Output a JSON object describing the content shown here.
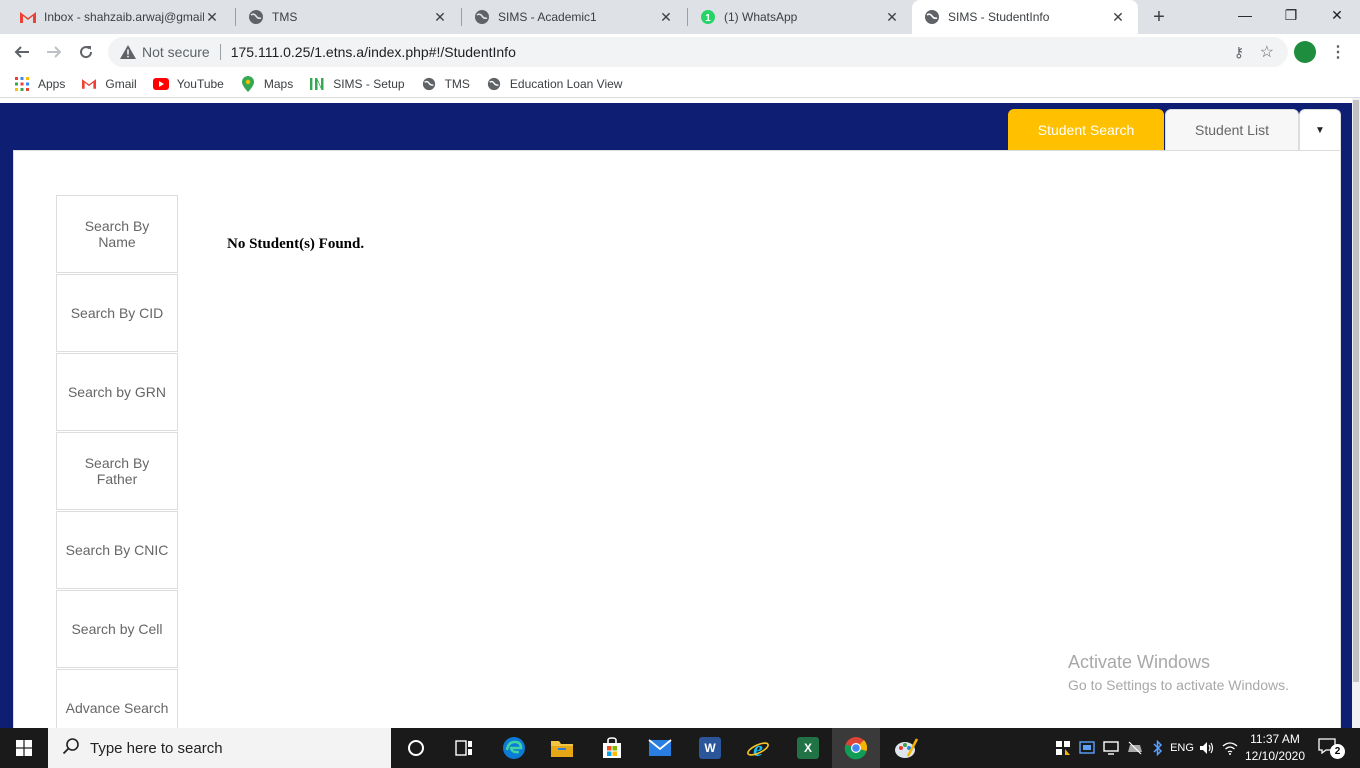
{
  "browser": {
    "tabs": [
      {
        "title": "Inbox - shahzaib.arwaj@gmail.",
        "icon": "gmail-icon"
      },
      {
        "title": "TMS",
        "icon": "globe-icon"
      },
      {
        "title": "SIMS - Academic1",
        "icon": "globe-icon"
      },
      {
        "title": "(1) WhatsApp",
        "icon": "whatsapp-icon",
        "badge": "1"
      },
      {
        "title": "SIMS - StudentInfo",
        "icon": "globe-icon"
      }
    ],
    "new_tab": "+",
    "security": "Not secure",
    "url": "175.111.0.25/1.etns.a/index.php#!/StudentInfo",
    "bookmarks": [
      "Apps",
      "Gmail",
      "YouTube",
      "Maps",
      "SIMS - Setup",
      "TMS",
      "Education Loan View"
    ]
  },
  "app": {
    "nav_tabs": {
      "student_search": "Student Search",
      "student_list": "Student List"
    },
    "side_buttons": [
      "Search By Name",
      "Search By CID",
      "Search by GRN",
      "Search By Father",
      "Search By CNIC",
      "Search by Cell",
      "Advance Search"
    ],
    "message": "No Student(s) Found.",
    "colors": {
      "header": "#0d1e73",
      "active_tab": "#ffc000"
    }
  },
  "watermark": {
    "line1": "Activate Windows",
    "line2": "Go to Settings to activate Windows."
  },
  "taskbar": {
    "search_placeholder": "Type here to search",
    "time": "11:37 AM",
    "date": "12/10/2020",
    "notifications": "2"
  }
}
